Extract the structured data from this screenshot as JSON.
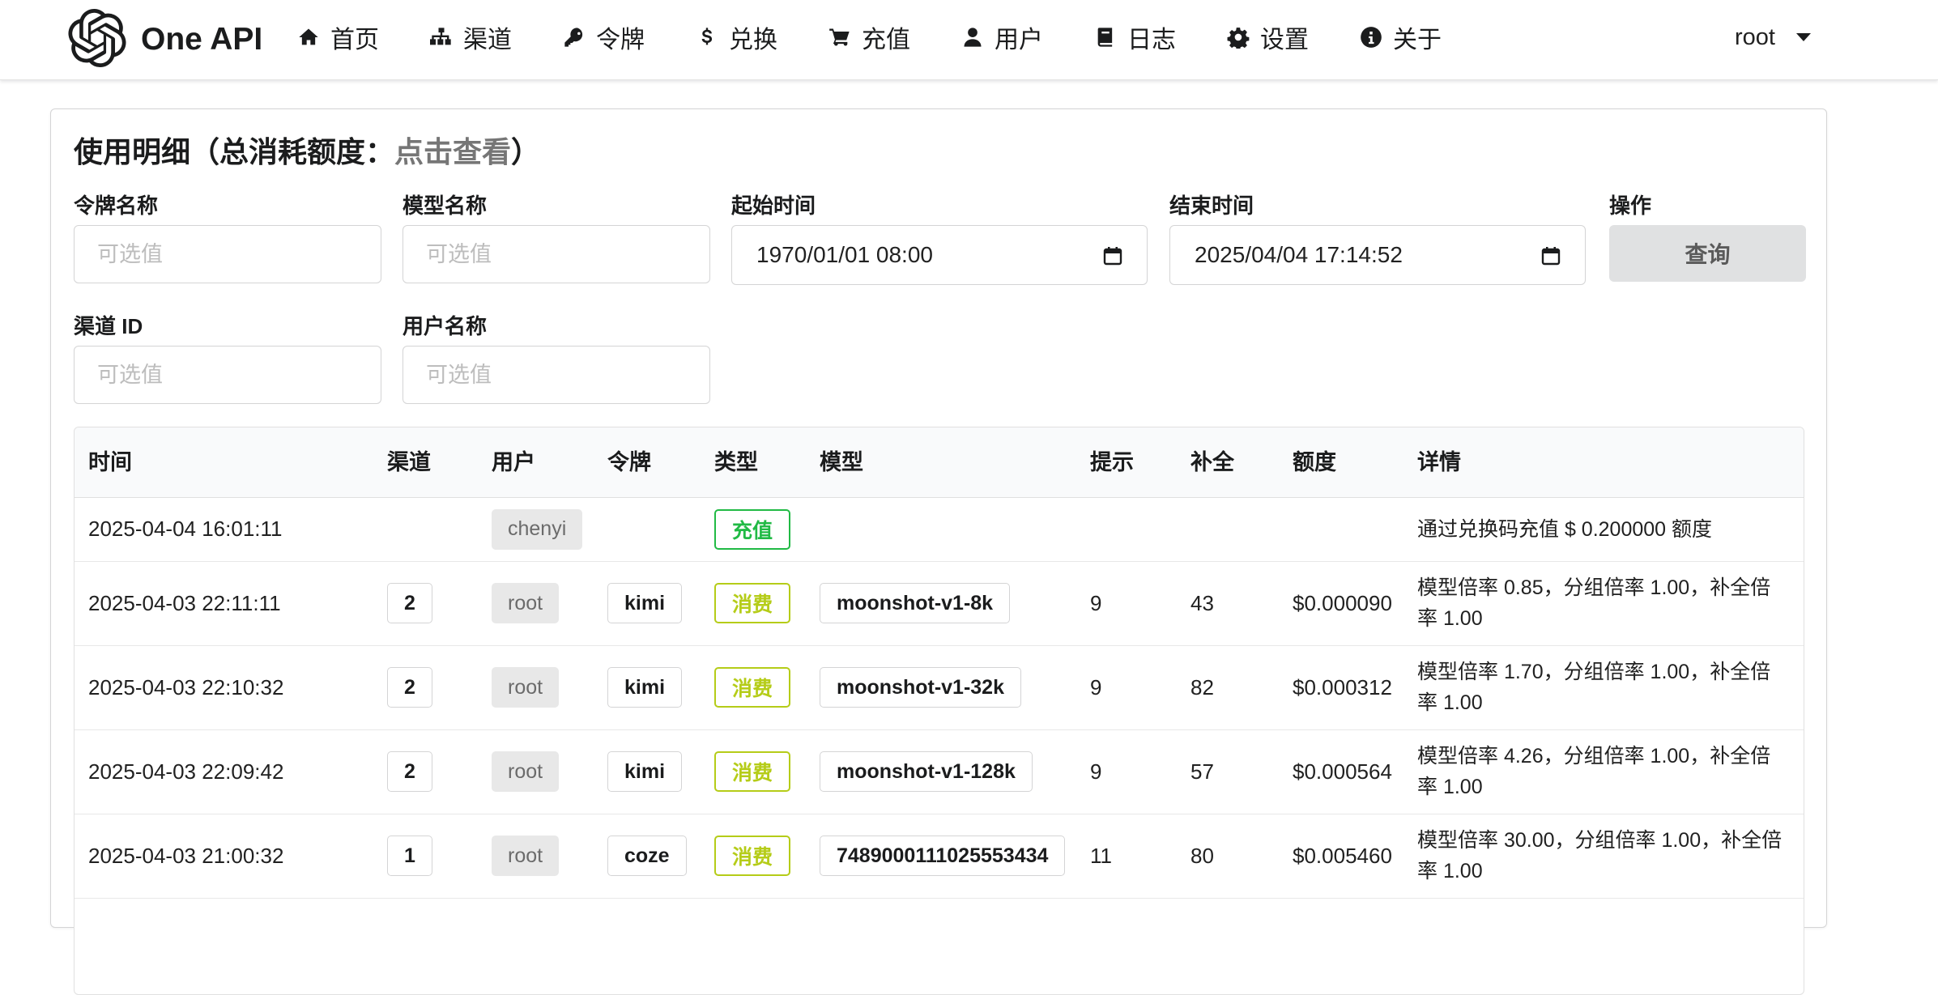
{
  "app": {
    "name": "One API"
  },
  "nav": {
    "items": [
      {
        "label": "首页",
        "icon": "home-icon"
      },
      {
        "label": "渠道",
        "icon": "sitemap-icon"
      },
      {
        "label": "令牌",
        "icon": "key-icon"
      },
      {
        "label": "兑换",
        "icon": "dollar-icon"
      },
      {
        "label": "充值",
        "icon": "cart-icon"
      },
      {
        "label": "用户",
        "icon": "user-icon"
      },
      {
        "label": "日志",
        "icon": "book-icon"
      },
      {
        "label": "设置",
        "icon": "gear-icon"
      },
      {
        "label": "关于",
        "icon": "info-icon"
      }
    ],
    "user": "root"
  },
  "page": {
    "title_prefix": "使用明细（总消耗额度：",
    "title_link": "点击查看",
    "title_suffix": "）"
  },
  "filters": {
    "token_name": {
      "label": "令牌名称",
      "placeholder": "可选值",
      "value": ""
    },
    "model_name": {
      "label": "模型名称",
      "placeholder": "可选值",
      "value": ""
    },
    "start_time": {
      "label": "起始时间",
      "value": "1970/01/01 08:00"
    },
    "end_time": {
      "label": "结束时间",
      "value": "2025/04/04 17:14:52"
    },
    "action": {
      "label": "操作",
      "button": "查询"
    },
    "channel_id": {
      "label": "渠道 ID",
      "placeholder": "可选值",
      "value": ""
    },
    "username": {
      "label": "用户名称",
      "placeholder": "可选值",
      "value": ""
    }
  },
  "table": {
    "headers": [
      "时间",
      "渠道",
      "用户",
      "令牌",
      "类型",
      "模型",
      "提示",
      "补全",
      "额度",
      "详情"
    ],
    "rows": [
      {
        "time": "2025-04-04 16:01:11",
        "channel": "",
        "user": "chenyi",
        "token": "",
        "type": "充值",
        "type_color": "#21ba45",
        "model": "",
        "prompt": "",
        "completion": "",
        "quota": "",
        "detail": "通过兑换码充值 $ 0.200000 额度"
      },
      {
        "time": "2025-04-03 22:11:11",
        "channel": "2",
        "user": "root",
        "token": "kimi",
        "type": "消费",
        "type_color": "#b5cc18",
        "model": "moonshot-v1-8k",
        "prompt": "9",
        "completion": "43",
        "quota": "$0.000090",
        "detail": "模型倍率 0.85，分组倍率 1.00，补全倍率 1.00"
      },
      {
        "time": "2025-04-03 22:10:32",
        "channel": "2",
        "user": "root",
        "token": "kimi",
        "type": "消费",
        "type_color": "#b5cc18",
        "model": "moonshot-v1-32k",
        "prompt": "9",
        "completion": "82",
        "quota": "$0.000312",
        "detail": "模型倍率 1.70，分组倍率 1.00，补全倍率 1.00"
      },
      {
        "time": "2025-04-03 22:09:42",
        "channel": "2",
        "user": "root",
        "token": "kimi",
        "type": "消费",
        "type_color": "#b5cc18",
        "model": "moonshot-v1-128k",
        "prompt": "9",
        "completion": "57",
        "quota": "$0.000564",
        "detail": "模型倍率 4.26，分组倍率 1.00，补全倍率 1.00"
      },
      {
        "time": "2025-04-03 21:00:32",
        "channel": "1",
        "user": "root",
        "token": "coze",
        "type": "消费",
        "type_color": "#b5cc18",
        "model": "7489000111025553434",
        "prompt": "11",
        "completion": "80",
        "quota": "$0.005460",
        "detail": "模型倍率 30.00，分组倍率 1.00，补全倍率 1.00"
      }
    ]
  }
}
